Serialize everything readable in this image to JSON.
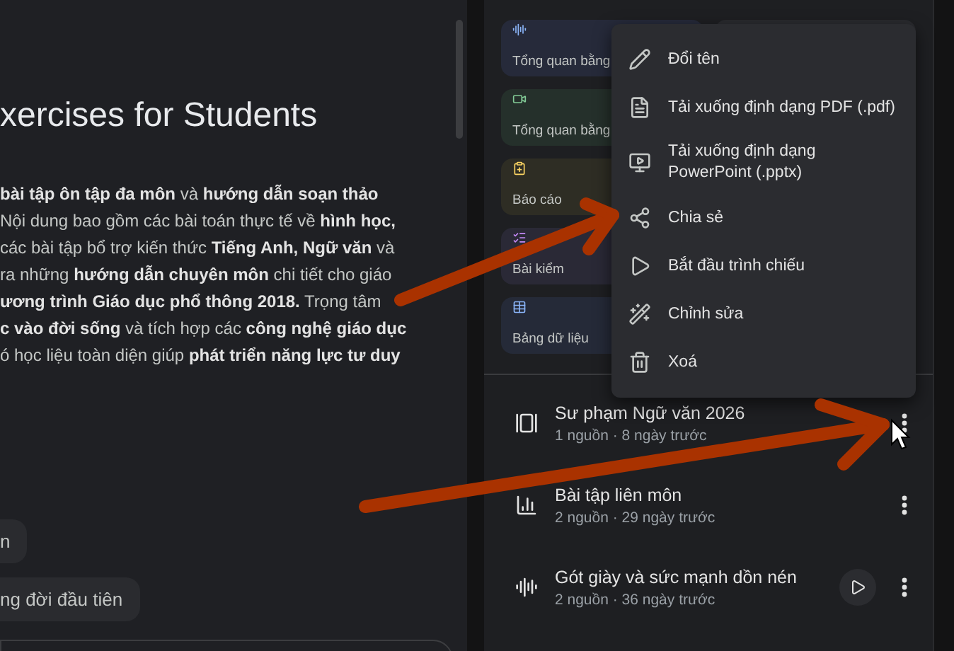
{
  "document": {
    "title": "xercises for Students",
    "paragraph_lines": [
      "**bài tập ôn tập đa môn** và **hướng dẫn soạn thảo**",
      "Nội dung bao gồm các bài toán thực tế về **hình học,**",
      "các bài tập bổ trợ kiến thức **Tiếng Anh, Ngữ văn** và",
      "ra những **hướng dẫn chuyên môn** chi tiết cho giáo",
      "**ương trình Giáo dục phổ thông 2018.** Trọng tâm",
      "**c vào đời sống** và tích hợp các **công nghệ giáo dục**",
      "ó học liệu toàn diện giúp **phát triển năng lực tư duy**"
    ]
  },
  "suggestions": [
    "n",
    "ng đời đầu tiên"
  ],
  "studio_tiles": [
    {
      "kind": "audio",
      "label": "Tổng quan bằng"
    },
    {
      "kind": "video",
      "label": "Tổng quan bằng"
    },
    {
      "kind": "report",
      "label": "Báo cáo"
    },
    {
      "kind": "quiz",
      "label": "Bài kiểm"
    },
    {
      "kind": "table",
      "label": "Bảng dữ liệu"
    }
  ],
  "context_menu": [
    {
      "kind": "rename",
      "label": "Đổi tên"
    },
    {
      "kind": "pdf",
      "label": "Tải xuống định dạng PDF (.pdf)"
    },
    {
      "kind": "pptx",
      "label": "Tải xuống định dạng PowerPoint (.pptx)"
    },
    {
      "kind": "share",
      "label": "Chia sẻ"
    },
    {
      "kind": "present",
      "label": "Bắt đầu trình chiếu"
    },
    {
      "kind": "edit",
      "label": "Chỉnh sửa"
    },
    {
      "kind": "delete",
      "label": "Xoá"
    }
  ],
  "notes": [
    {
      "kind": "slides",
      "title": "Sư phạm Ngữ văn 2026",
      "meta": "1 nguồn · 8 ngày trước",
      "playable": false
    },
    {
      "kind": "chart",
      "title": "Bài tập liên môn",
      "meta": "2 nguồn · 29 ngày trước",
      "playable": false
    },
    {
      "kind": "audio",
      "title": "Gót giày và sức mạnh dồn nén",
      "meta": "2 nguồn · 36 ngày trước",
      "playable": true
    }
  ]
}
